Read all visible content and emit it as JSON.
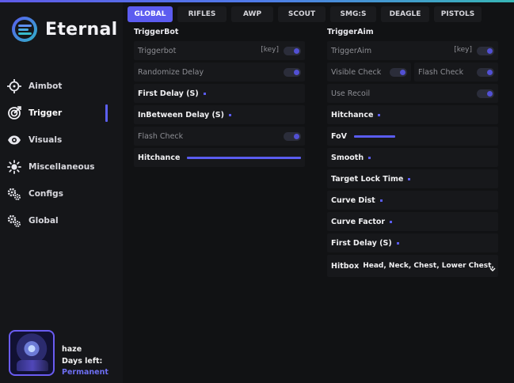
{
  "app": {
    "name": "Eternal"
  },
  "sidebar": {
    "items": [
      {
        "label": "Aimbot",
        "icon": "crosshair-icon"
      },
      {
        "label": "Trigger",
        "icon": "target-icon",
        "active": true
      },
      {
        "label": "Visuals",
        "icon": "eye-icon"
      },
      {
        "label": "Miscellaneous",
        "icon": "sun-icon"
      },
      {
        "label": "Configs",
        "icon": "gears-icon"
      },
      {
        "label": "Global",
        "icon": "gears-icon"
      }
    ]
  },
  "profile": {
    "username": "haze",
    "days_label": "Days left:",
    "days_value": "Permanent"
  },
  "tabs": [
    {
      "label": "GLOBAL",
      "active": true
    },
    {
      "label": "RIFLES"
    },
    {
      "label": "AWP"
    },
    {
      "label": "SCOUT"
    },
    {
      "label": "SMG:S"
    },
    {
      "label": "DEAGLE"
    },
    {
      "label": "PISTOLS"
    }
  ],
  "triggerbot": {
    "title": "TriggerBot",
    "triggerbot_label": "Triggerbot",
    "key_label": "[key]",
    "randomize_label": "Randomize Delay",
    "first_delay_label": "First Delay (S)",
    "inbetween_label": "InBetween Delay (S)",
    "flash_label": "Flash Check",
    "hitchance_label": "Hitchance",
    "hitchance_value": 1.0
  },
  "triggeraim": {
    "title": "TriggerAim",
    "triggeraim_label": "TriggerAim",
    "key_label": "[key]",
    "visible_label": "Visible Check",
    "flash_label": "Flash Check",
    "recoil_label": "Use Recoil",
    "hitchance_label": "Hitchance",
    "fov_label": "FoV",
    "fov_value": 0.25,
    "smooth_label": "Smooth",
    "lock_time_label": "Target Lock Time",
    "curve_dist_label": "Curve Dist",
    "curve_factor_label": "Curve Factor",
    "first_delay_label": "First Delay (S)",
    "hitbox_label": "Hitbox",
    "hitbox_value": "Head, Neck, Chest, Lower Chest, Pelvis"
  },
  "colors": {
    "accent": "#5c5cf0",
    "background": "#111214",
    "row": "#17181b"
  }
}
